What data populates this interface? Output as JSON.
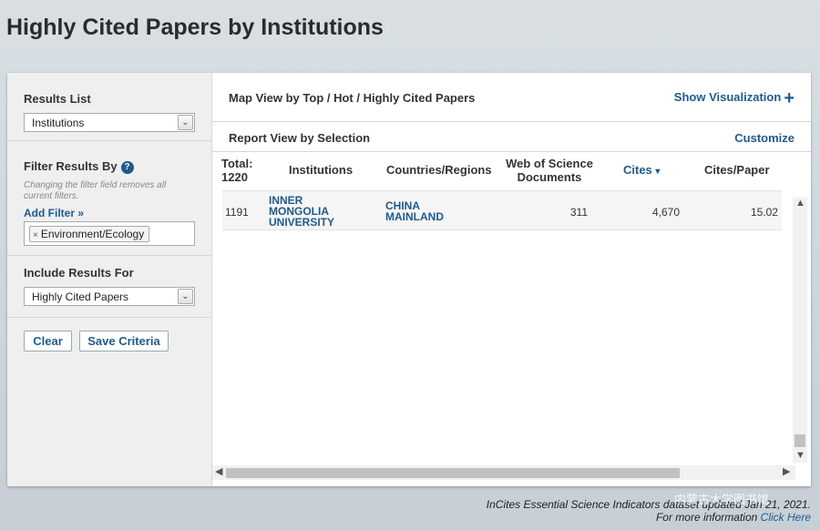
{
  "page": {
    "title": "Highly Cited Papers by Institutions"
  },
  "sidebar": {
    "results_list": {
      "label": "Results List",
      "selected": "Institutions"
    },
    "filter": {
      "label": "Filter Results By",
      "help_icon": "?",
      "note": "Changing the filter field removes all current filters.",
      "add_filter": "Add Filter »",
      "tags": [
        {
          "remove": "×",
          "label": "Environment/Ecology"
        }
      ]
    },
    "include": {
      "label": "Include Results For",
      "selected": "Highly Cited Papers"
    },
    "buttons": {
      "clear": "Clear",
      "save": "Save Criteria"
    },
    "dropdown_arrow": "⌄"
  },
  "main": {
    "map_view": {
      "label": "Map View by Top / Hot / Highly Cited Papers",
      "show_visualization": "Show Visualization",
      "plus": "+"
    },
    "report_view": {
      "label": "Report View by Selection",
      "customize": "Customize"
    },
    "table": {
      "total_label": "Total:",
      "total_value": "1220",
      "columns": {
        "institutions": "Institutions",
        "countries": "Countries/Regions",
        "wos_line1": "Web of Science",
        "wos_line2": "Documents",
        "cites": "Cites",
        "cites_sort": "▾",
        "cites_per_paper": "Cites/Paper"
      },
      "rows": [
        {
          "rank": "1191",
          "institution": [
            "INNER",
            "MONGOLIA",
            "UNIVERSITY"
          ],
          "country": [
            "CHINA",
            "MAINLAND"
          ],
          "documents": "311",
          "cites": "4,670",
          "cites_per_paper": "15.02"
        }
      ]
    },
    "scroll": {
      "up": "▲",
      "down": "▼",
      "left": "◀",
      "right": "▶"
    }
  },
  "footer": {
    "line1": "InCites Essential Science Indicators dataset updated Jan 21, 2021.",
    "line2_prefix": "For more information ",
    "line2_link": "Click Here"
  },
  "watermark": "内蒙古大学图书馆",
  "colors": {
    "accent": "#1f5a8c"
  }
}
